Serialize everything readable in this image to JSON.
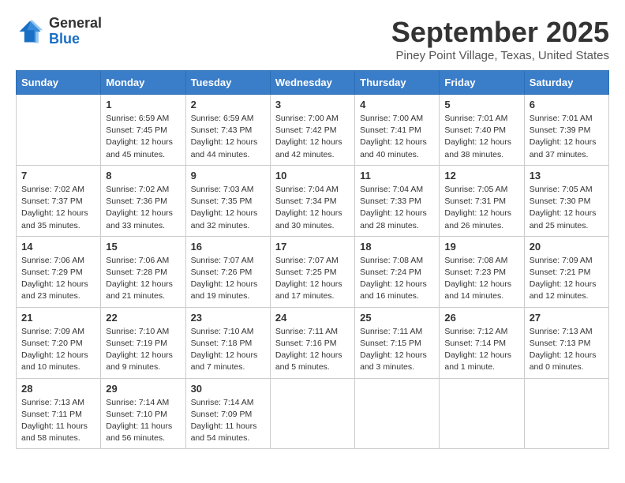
{
  "header": {
    "logo_line1": "General",
    "logo_line2": "Blue",
    "month": "September 2025",
    "location": "Piney Point Village, Texas, United States"
  },
  "weekdays": [
    "Sunday",
    "Monday",
    "Tuesday",
    "Wednesday",
    "Thursday",
    "Friday",
    "Saturday"
  ],
  "weeks": [
    [
      {
        "day": "",
        "info": ""
      },
      {
        "day": "1",
        "info": "Sunrise: 6:59 AM\nSunset: 7:45 PM\nDaylight: 12 hours\nand 45 minutes."
      },
      {
        "day": "2",
        "info": "Sunrise: 6:59 AM\nSunset: 7:43 PM\nDaylight: 12 hours\nand 44 minutes."
      },
      {
        "day": "3",
        "info": "Sunrise: 7:00 AM\nSunset: 7:42 PM\nDaylight: 12 hours\nand 42 minutes."
      },
      {
        "day": "4",
        "info": "Sunrise: 7:00 AM\nSunset: 7:41 PM\nDaylight: 12 hours\nand 40 minutes."
      },
      {
        "day": "5",
        "info": "Sunrise: 7:01 AM\nSunset: 7:40 PM\nDaylight: 12 hours\nand 38 minutes."
      },
      {
        "day": "6",
        "info": "Sunrise: 7:01 AM\nSunset: 7:39 PM\nDaylight: 12 hours\nand 37 minutes."
      }
    ],
    [
      {
        "day": "7",
        "info": "Sunrise: 7:02 AM\nSunset: 7:37 PM\nDaylight: 12 hours\nand 35 minutes."
      },
      {
        "day": "8",
        "info": "Sunrise: 7:02 AM\nSunset: 7:36 PM\nDaylight: 12 hours\nand 33 minutes."
      },
      {
        "day": "9",
        "info": "Sunrise: 7:03 AM\nSunset: 7:35 PM\nDaylight: 12 hours\nand 32 minutes."
      },
      {
        "day": "10",
        "info": "Sunrise: 7:04 AM\nSunset: 7:34 PM\nDaylight: 12 hours\nand 30 minutes."
      },
      {
        "day": "11",
        "info": "Sunrise: 7:04 AM\nSunset: 7:33 PM\nDaylight: 12 hours\nand 28 minutes."
      },
      {
        "day": "12",
        "info": "Sunrise: 7:05 AM\nSunset: 7:31 PM\nDaylight: 12 hours\nand 26 minutes."
      },
      {
        "day": "13",
        "info": "Sunrise: 7:05 AM\nSunset: 7:30 PM\nDaylight: 12 hours\nand 25 minutes."
      }
    ],
    [
      {
        "day": "14",
        "info": "Sunrise: 7:06 AM\nSunset: 7:29 PM\nDaylight: 12 hours\nand 23 minutes."
      },
      {
        "day": "15",
        "info": "Sunrise: 7:06 AM\nSunset: 7:28 PM\nDaylight: 12 hours\nand 21 minutes."
      },
      {
        "day": "16",
        "info": "Sunrise: 7:07 AM\nSunset: 7:26 PM\nDaylight: 12 hours\nand 19 minutes."
      },
      {
        "day": "17",
        "info": "Sunrise: 7:07 AM\nSunset: 7:25 PM\nDaylight: 12 hours\nand 17 minutes."
      },
      {
        "day": "18",
        "info": "Sunrise: 7:08 AM\nSunset: 7:24 PM\nDaylight: 12 hours\nand 16 minutes."
      },
      {
        "day": "19",
        "info": "Sunrise: 7:08 AM\nSunset: 7:23 PM\nDaylight: 12 hours\nand 14 minutes."
      },
      {
        "day": "20",
        "info": "Sunrise: 7:09 AM\nSunset: 7:21 PM\nDaylight: 12 hours\nand 12 minutes."
      }
    ],
    [
      {
        "day": "21",
        "info": "Sunrise: 7:09 AM\nSunset: 7:20 PM\nDaylight: 12 hours\nand 10 minutes."
      },
      {
        "day": "22",
        "info": "Sunrise: 7:10 AM\nSunset: 7:19 PM\nDaylight: 12 hours\nand 9 minutes."
      },
      {
        "day": "23",
        "info": "Sunrise: 7:10 AM\nSunset: 7:18 PM\nDaylight: 12 hours\nand 7 minutes."
      },
      {
        "day": "24",
        "info": "Sunrise: 7:11 AM\nSunset: 7:16 PM\nDaylight: 12 hours\nand 5 minutes."
      },
      {
        "day": "25",
        "info": "Sunrise: 7:11 AM\nSunset: 7:15 PM\nDaylight: 12 hours\nand 3 minutes."
      },
      {
        "day": "26",
        "info": "Sunrise: 7:12 AM\nSunset: 7:14 PM\nDaylight: 12 hours\nand 1 minute."
      },
      {
        "day": "27",
        "info": "Sunrise: 7:13 AM\nSunset: 7:13 PM\nDaylight: 12 hours\nand 0 minutes."
      }
    ],
    [
      {
        "day": "28",
        "info": "Sunrise: 7:13 AM\nSunset: 7:11 PM\nDaylight: 11 hours\nand 58 minutes."
      },
      {
        "day": "29",
        "info": "Sunrise: 7:14 AM\nSunset: 7:10 PM\nDaylight: 11 hours\nand 56 minutes."
      },
      {
        "day": "30",
        "info": "Sunrise: 7:14 AM\nSunset: 7:09 PM\nDaylight: 11 hours\nand 54 minutes."
      },
      {
        "day": "",
        "info": ""
      },
      {
        "day": "",
        "info": ""
      },
      {
        "day": "",
        "info": ""
      },
      {
        "day": "",
        "info": ""
      }
    ]
  ]
}
